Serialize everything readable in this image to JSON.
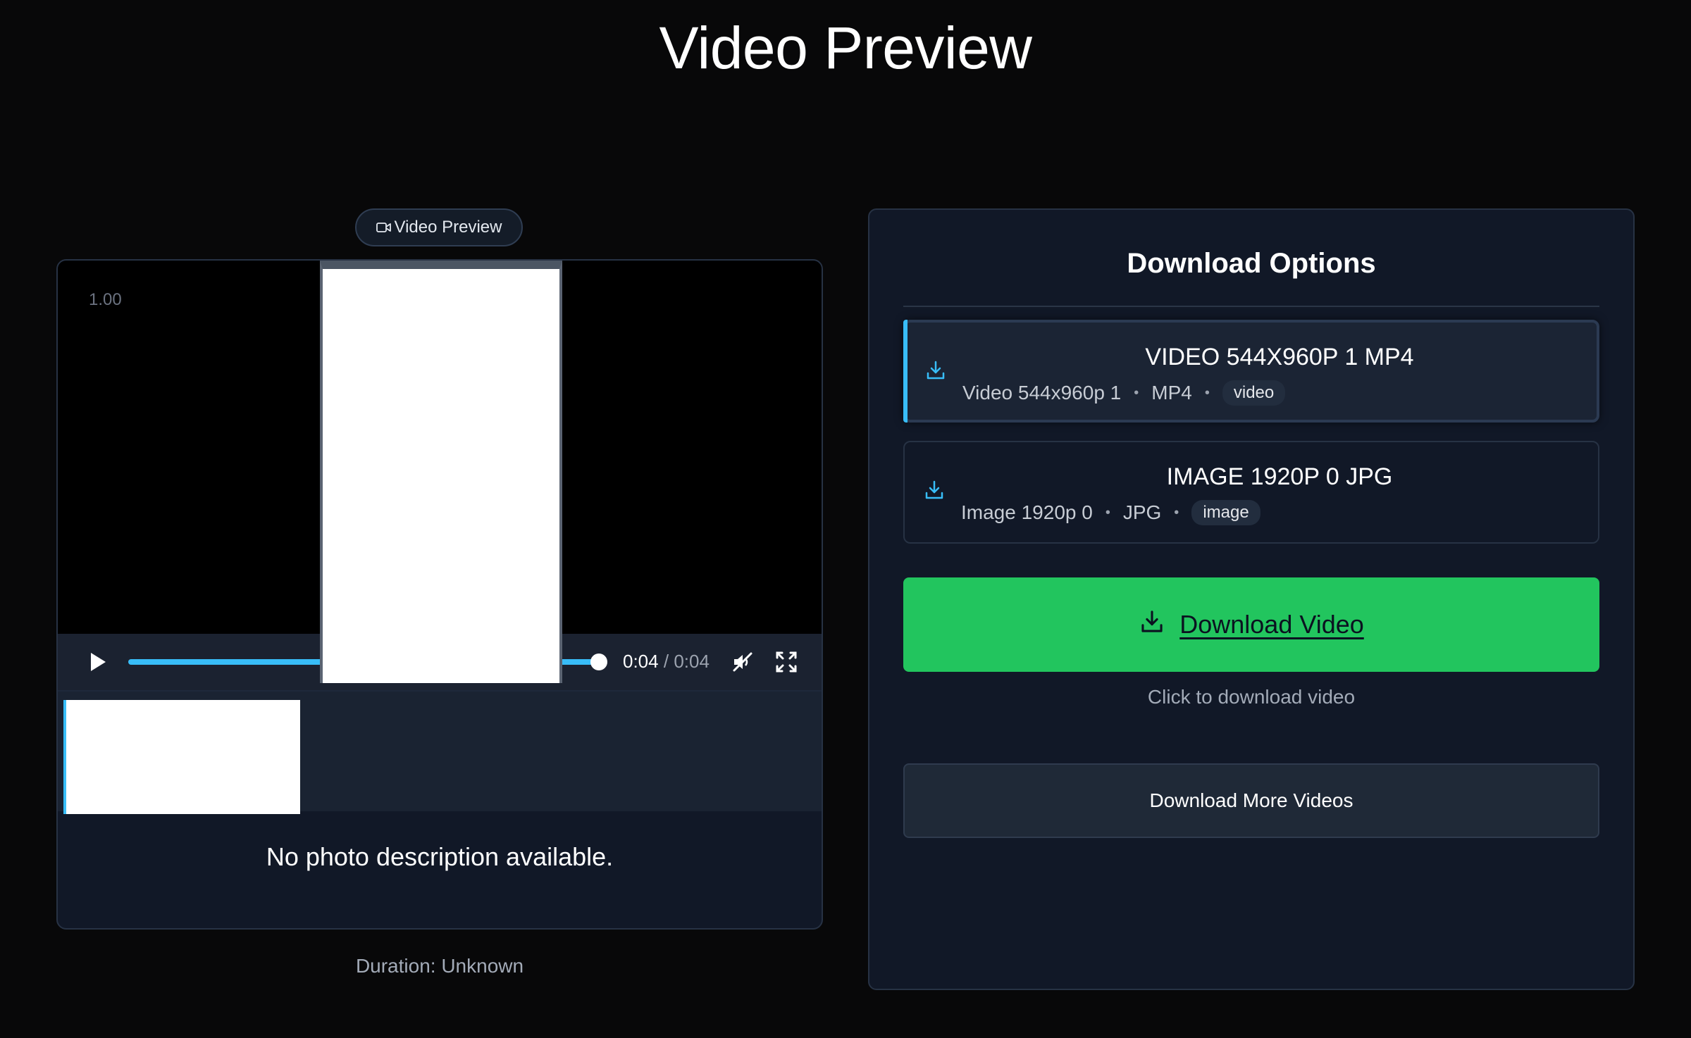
{
  "page": {
    "title": "Video Preview"
  },
  "preview": {
    "badge_label": "Video Preview",
    "speed": "1.00",
    "time_current": "0:04",
    "time_separator": "/",
    "time_total": "0:04",
    "progress_fraction": 1.0,
    "photo_description": "No photo description available.",
    "duration": "Duration: Unknown"
  },
  "download": {
    "title": "Download Options",
    "options": [
      {
        "title": "VIDEO 544X960P 1 MP4",
        "name": "Video 544x960p 1",
        "format": "MP4",
        "type": "video",
        "selected": true
      },
      {
        "title": "IMAGE 1920P 0 JPG",
        "name": "Image 1920p 0",
        "format": "JPG",
        "type": "image",
        "selected": false
      }
    ],
    "button_label": "Download Video",
    "hint": "Click to download video",
    "more_label": "Download More Videos"
  },
  "colors": {
    "accent": "#38bdf8",
    "download_button": "#22c55e",
    "panel": "#111827",
    "background": "#080809"
  },
  "icons": {
    "badge": "video-camera-icon",
    "play": "play-icon",
    "mute": "volume-muted-icon",
    "fullscreen": "fullscreen-icon",
    "download": "download-icon"
  }
}
